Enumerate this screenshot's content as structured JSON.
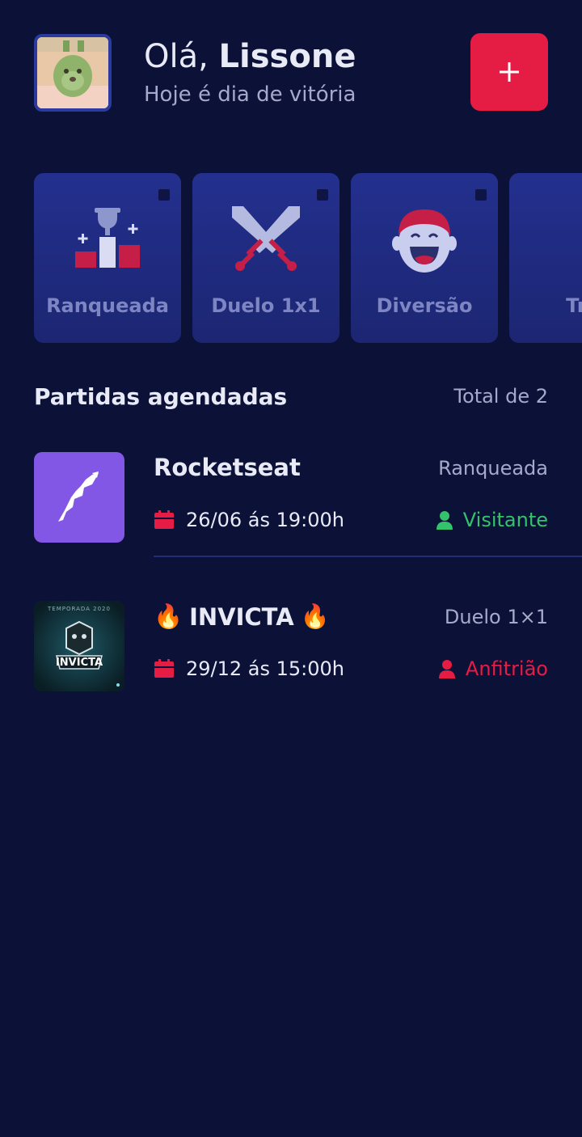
{
  "header": {
    "greeting_hello": "Olá,",
    "user_name": "Lissone",
    "subtitle": "Hoje é dia de vitória",
    "add_label": "+"
  },
  "categories": [
    {
      "label": "Ranqueada",
      "icon": "trophy-podium-icon"
    },
    {
      "label": "Duelo 1x1",
      "icon": "crossed-swords-icon"
    },
    {
      "label": "Diversão",
      "icon": "laughing-face-icon"
    },
    {
      "label": "Tre",
      "icon": "gamepad-icon"
    }
  ],
  "section": {
    "title": "Partidas agendadas",
    "total": "Total de 2"
  },
  "matches": [
    {
      "name": "Rocketseat",
      "mode": "Ranqueada",
      "date": "26/06 ás 19:00h",
      "role": "Visitante",
      "role_color": "#34c26b",
      "thumb_color": "#8257e5"
    },
    {
      "name": "INVICTA",
      "name_emoji": "🔥",
      "mode": "Duelo 1×1",
      "date": "29/12 ás 15:00h",
      "role": "Anfitrião",
      "role_color": "#e51c44",
      "thumb_logo_text": "INVICTA",
      "thumb_top_text": "TEMPORADA 2020"
    }
  ],
  "colors": {
    "background": "#0c1138",
    "accent": "#e51c44",
    "card": "#23308e",
    "muted_text": "#a6a9c9"
  }
}
